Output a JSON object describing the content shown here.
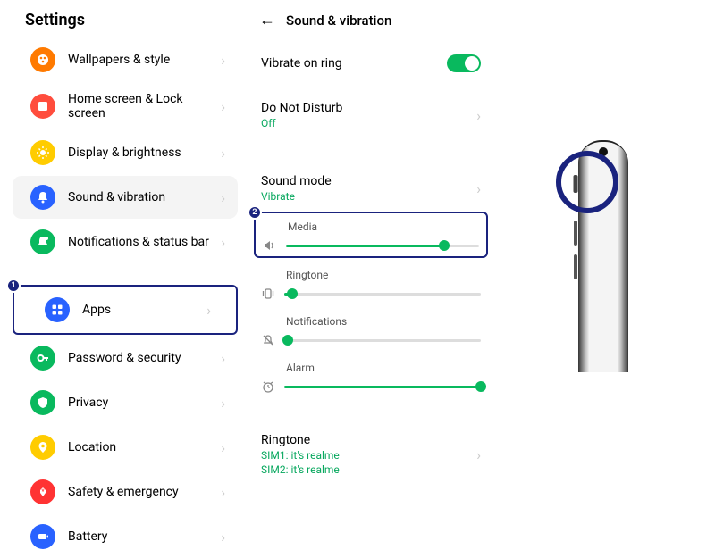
{
  "settings": {
    "title": "Settings",
    "items": [
      {
        "label": "Wallpapers & style",
        "icon": "palette",
        "bg": "#ff7a00"
      },
      {
        "label": "Home screen & Lock screen",
        "icon": "image",
        "bg": "#ff4d3d"
      },
      {
        "label": "Display & brightness",
        "icon": "sun",
        "bg": "#ffcc00"
      },
      {
        "label": "Sound & vibration",
        "icon": "bell",
        "bg": "#2962ff",
        "selected": true
      },
      {
        "label": "Notifications & status bar",
        "icon": "bell-dot",
        "bg": "#09b95e"
      },
      {
        "label": "Apps",
        "icon": "grid",
        "bg": "#2962ff",
        "highlighted": true,
        "callout": "1"
      },
      {
        "label": "Password & security",
        "icon": "key",
        "bg": "#09b95e"
      },
      {
        "label": "Privacy",
        "icon": "shield",
        "bg": "#09b95e"
      },
      {
        "label": "Location",
        "icon": "pin",
        "bg": "#ffcc00"
      },
      {
        "label": "Safety & emergency",
        "icon": "star",
        "bg": "#ff3333"
      },
      {
        "label": "Battery",
        "icon": "battery",
        "bg": "#2962ff"
      }
    ]
  },
  "sound": {
    "title": "Sound & vibration",
    "vibrate_on_ring": {
      "label": "Vibrate on ring",
      "value": true
    },
    "dnd": {
      "label": "Do Not Disturb",
      "sub": "Off"
    },
    "sound_mode": {
      "label": "Sound mode",
      "sub": "Vibrate"
    },
    "sliders": [
      {
        "key": "media",
        "label": "Media",
        "icon": "speaker",
        "percent": 82,
        "callout": "2",
        "highlighted": true
      },
      {
        "key": "ringtone",
        "label": "Ringtone",
        "icon": "phone-vibe",
        "percent": 4
      },
      {
        "key": "notifications",
        "label": "Notifications",
        "icon": "bell-off",
        "percent": 2
      },
      {
        "key": "alarm",
        "label": "Alarm",
        "icon": "alarm",
        "percent": 100
      }
    ],
    "ringtone_section": {
      "label": "Ringtone",
      "sim1": "SIM1: it's realme",
      "sim2": "SIM2: it's realme"
    }
  },
  "phone_annotation": {
    "element": "mute-switch"
  }
}
